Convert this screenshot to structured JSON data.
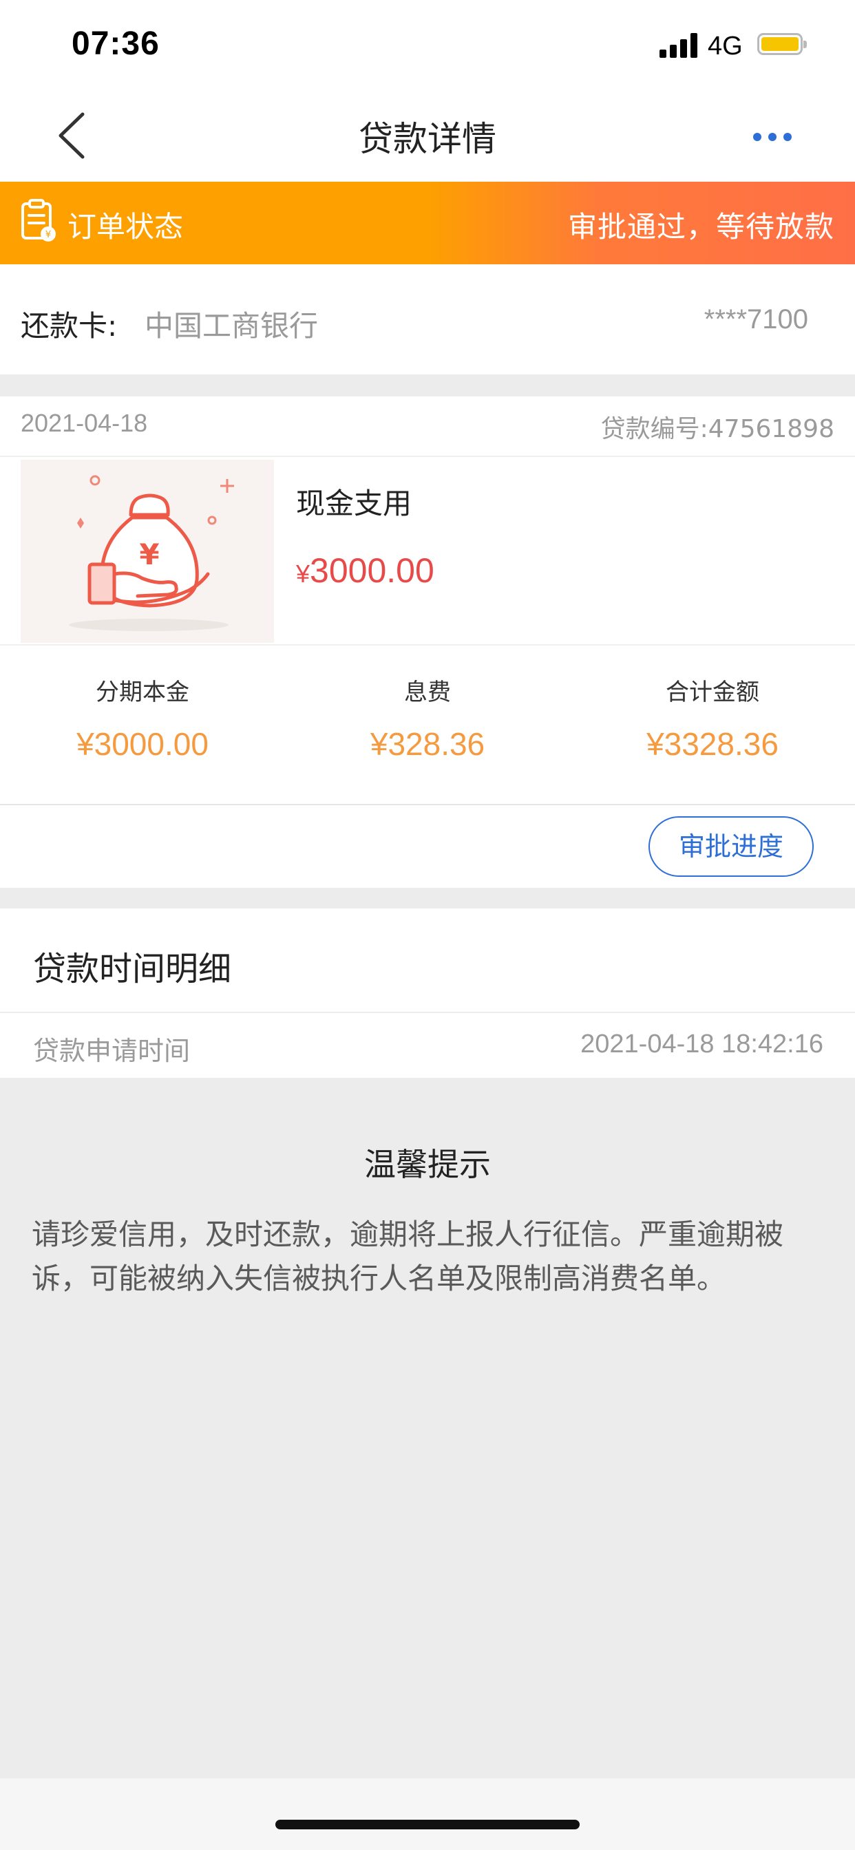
{
  "status_bar": {
    "time": "07:36",
    "network": "4G",
    "icons": [
      "signal-icon",
      "battery-icon"
    ]
  },
  "nav": {
    "title": "贷款详情",
    "icons": [
      "back-icon",
      "more-icon"
    ]
  },
  "order": {
    "label": "订单状态",
    "status": "审批通过，等待放款",
    "icon": "clipboard-icon",
    "gradient_colors": [
      "#fda000",
      "#ff6f47"
    ]
  },
  "repay_card": {
    "label": "还款卡:",
    "bank": "中国工商银行",
    "number": "****7100"
  },
  "loan": {
    "date": "2021-04-18",
    "number_label": "贷款编号:47561898",
    "product_name": "现金支用",
    "product_icon": "money-bag-hand-icon",
    "price_symbol": "¥",
    "price": "3000.00",
    "stats": [
      {
        "label": "分期本金",
        "value": "¥3000.00"
      },
      {
        "label": "息费",
        "value": "¥328.36"
      },
      {
        "label": "合计金额",
        "value": "¥3328.36"
      }
    ],
    "progress_button": "审批进度"
  },
  "time_detail": {
    "title": "贷款时间明细",
    "apply_label": "贷款申请时间",
    "apply_time": "2021-04-18 18:42:16"
  },
  "tips": {
    "title": "温馨提示",
    "text": "请珍爱信用，及时还款，逾期将上报人行征信。严重逾期被诉，可能被纳入失信被执行人名单及限制高消费名单。"
  },
  "colors": {
    "accent_blue": "#2d6fd6",
    "price_red": "#e84a4a",
    "stat_orange": "#f59a3f"
  }
}
